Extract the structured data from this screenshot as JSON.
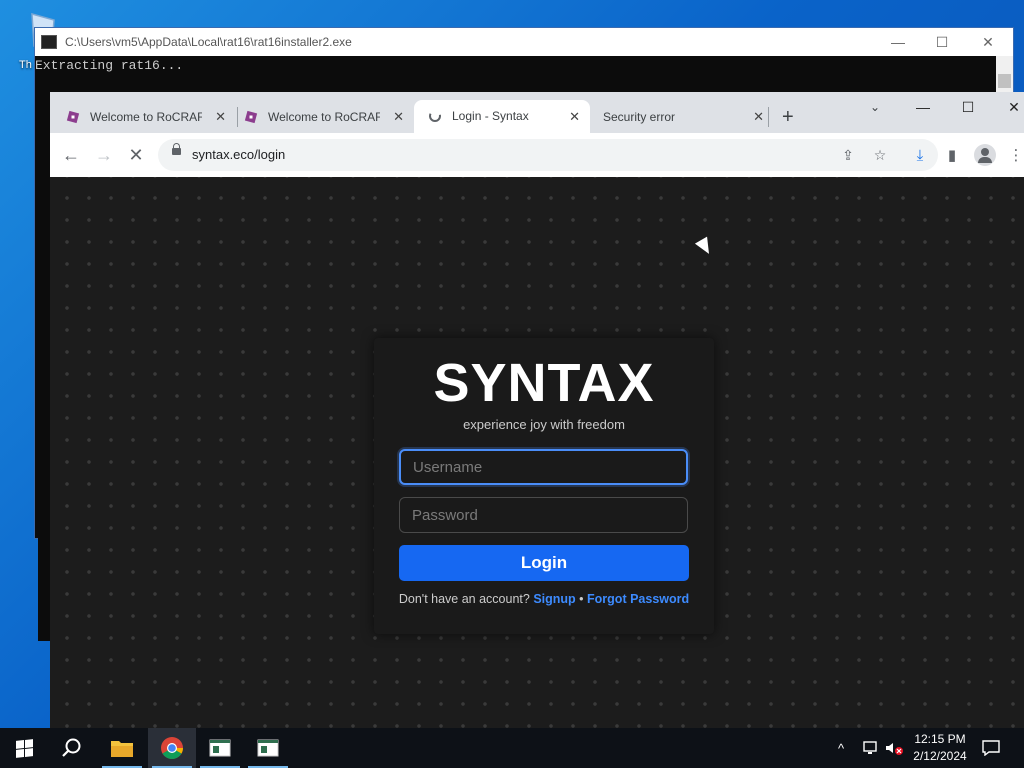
{
  "console": {
    "title": "C:\\Users\\vm5\\AppData\\Local\\rat16\\rat16installer2.exe",
    "output": "Extracting rat16...",
    "desk_fragment": "Th"
  },
  "browser": {
    "tabs": [
      {
        "title": "Welcome to RoCRAFT",
        "favicon": "roblox-icon",
        "active": false
      },
      {
        "title": "Welcome to RoCRAFT",
        "favicon": "roblox-icon",
        "active": false
      },
      {
        "title": "Login - Syntax",
        "favicon": "loading-icon",
        "active": true
      },
      {
        "title": "Security error",
        "favicon": "none",
        "active": false
      }
    ],
    "new_tab": "+",
    "url": "syntax.eco/login"
  },
  "page": {
    "brand": "SYNTAX",
    "tagline": "experience joy with freedom",
    "username_placeholder": "Username",
    "password_placeholder": "Password",
    "login_label": "Login",
    "footer_prompt": "Don't have an account?",
    "signup_label": "Signup",
    "separator": "•",
    "forgot_label": "Forgot Password"
  },
  "taskbar": {
    "time": "12:15 PM",
    "date": "2/12/2024"
  },
  "colors": {
    "accent": "#1668f2",
    "link": "#3d8bff",
    "page_bg": "#1c1c1c"
  }
}
